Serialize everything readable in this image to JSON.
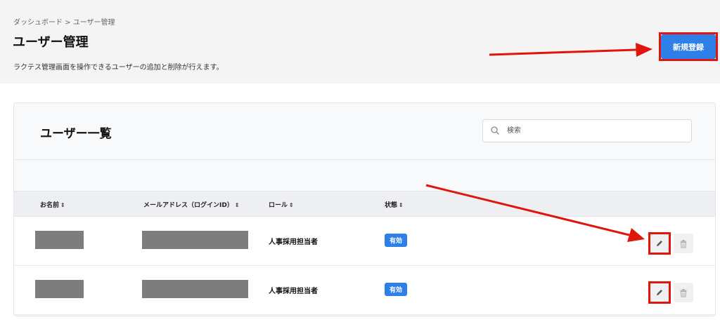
{
  "header": {
    "breadcrumb": "ダッシュボード > ユーザー管理",
    "title": "ユーザー管理",
    "description": "ラクテス管理画面を操作できるユーザーの追加と削除が行えます。",
    "new_button_label": "新規登録"
  },
  "card": {
    "title": "ユーザー一覧",
    "search": {
      "placeholder": "検索",
      "value": ""
    },
    "columns": [
      {
        "label": "お名前",
        "sort": "⇕"
      },
      {
        "label": "メールアドレス（ログインID）",
        "sort": "⇕"
      },
      {
        "label": "ロール",
        "sort": "⇕"
      },
      {
        "label": "状態",
        "sort": "⇕"
      }
    ],
    "rows": [
      {
        "name": "",
        "email": "",
        "role": "人事採用担当者",
        "status": "有効"
      },
      {
        "name": "",
        "email": "",
        "role": "人事採用担当者",
        "status": "有効"
      }
    ]
  },
  "annotations": {
    "color": "#e0150c"
  },
  "colors": {
    "primary": "#2f7fe8",
    "header_bg": "#f4f4f5",
    "redaction": "#7d7d7d"
  },
  "icons": [
    "search-icon",
    "pencil-icon",
    "trash-icon",
    "sort-icon"
  ]
}
